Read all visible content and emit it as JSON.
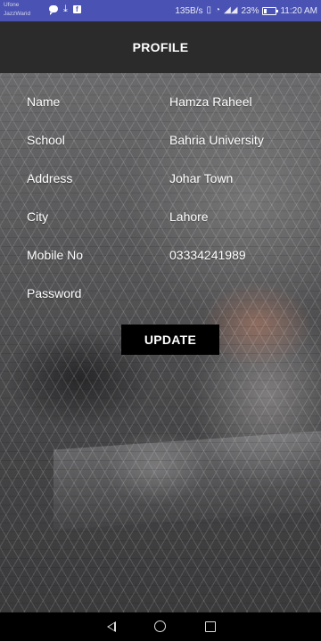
{
  "status_bar": {
    "carrier_line1": "Ufone",
    "carrier_line2": "JazzWarid",
    "network_speed": "135B/s",
    "signal_text": "ᴴᴳ",
    "battery_percent": "23%",
    "time": "11:20 AM",
    "icons": [
      "chat-bubble-icon",
      "download-icon",
      "facebook-icon",
      "vibrate-icon",
      "wifi-icon",
      "signal-icon",
      "battery-icon"
    ]
  },
  "header": {
    "title": "PROFILE"
  },
  "profile": {
    "fields": [
      {
        "label": "Name",
        "value": "Hamza Raheel"
      },
      {
        "label": "School",
        "value": "Bahria University"
      },
      {
        "label": "Address",
        "value": "Johar Town"
      },
      {
        "label": "City",
        "value": "Lahore"
      },
      {
        "label": "Mobile No",
        "value": "03334241989"
      },
      {
        "label": "Password",
        "value": ""
      }
    ]
  },
  "actions": {
    "update_label": "UPDATE"
  },
  "nav_bar": {
    "icons": [
      "back-icon",
      "home-icon",
      "recent-apps-icon"
    ]
  },
  "colors": {
    "status_bar": "#4a52b3",
    "header": "#2b2b2b",
    "button": "#000000",
    "nav_bar": "#000000"
  }
}
